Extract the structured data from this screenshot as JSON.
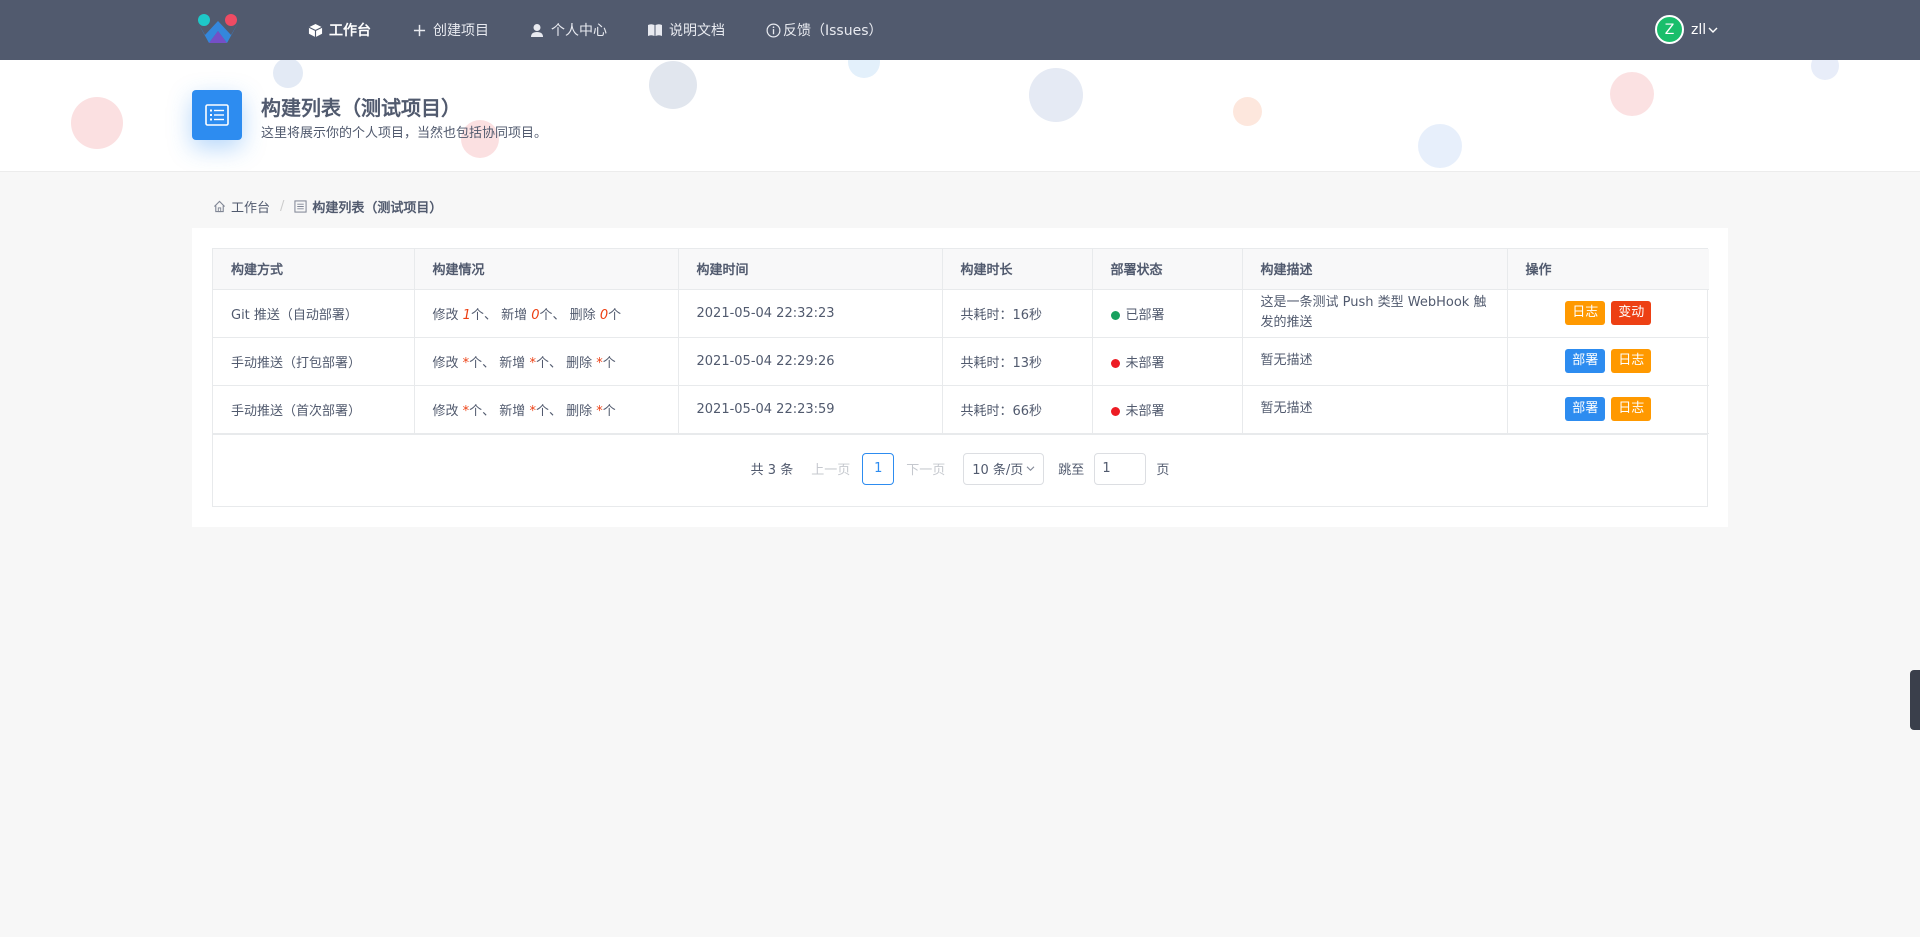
{
  "nav": {
    "items": [
      {
        "label": "工作台",
        "icon": "cube-icon",
        "active": true
      },
      {
        "label": "创建项目",
        "icon": "plus-icon"
      },
      {
        "label": "个人中心",
        "icon": "user-icon"
      },
      {
        "label": "说明文档",
        "icon": "book-icon"
      },
      {
        "label": "反馈（Issues）",
        "icon": "info-icon"
      }
    ]
  },
  "user": {
    "avatar_letter": "Z",
    "name": "zll"
  },
  "header": {
    "title": "构建列表（测试项目）",
    "subtitle": "这里将展示你的个人项目，当然也包括协同项目。"
  },
  "breadcrumb": {
    "home": "工作台",
    "current": "构建列表（测试项目）"
  },
  "table": {
    "columns": [
      "构建方式",
      "构建情况",
      "构建时间",
      "构建时长",
      "部署状态",
      "构建描述",
      "操作"
    ],
    "rows": [
      {
        "method": "Git 推送（自动部署）",
        "stats": {
          "modify_label": "修改",
          "modify": "1",
          "add_label": "、 新增",
          "add": "0",
          "del_label": "、 删除",
          "del": "0",
          "unit": "个"
        },
        "time": "2021-05-04 22:32:23",
        "duration": "共耗时：16秒",
        "status": "已部署",
        "status_color": "#19a15f",
        "description": "这是一条测试 Push 类型 WebHook 触发的推送",
        "ops": [
          {
            "label": "日志",
            "color": "orange"
          },
          {
            "label": "变动",
            "color": "red"
          }
        ]
      },
      {
        "method": "手动推送（打包部署）",
        "stats": {
          "modify_label": "修改",
          "modify": "*",
          "add_label": "、 新增",
          "add": "*",
          "del_label": "、 删除",
          "del": "*",
          "unit": "个"
        },
        "time": "2021-05-04 22:29:26",
        "duration": "共耗时：13秒",
        "status": "未部署",
        "status_color": "#ed1c24",
        "description": "暂无描述",
        "ops": [
          {
            "label": "部署",
            "color": "blue"
          },
          {
            "label": "日志",
            "color": "orange"
          }
        ]
      },
      {
        "method": "手动推送（首次部署）",
        "stats": {
          "modify_label": "修改",
          "modify": "*",
          "add_label": "、 新增",
          "add": "*",
          "del_label": "、 删除",
          "del": "*",
          "unit": "个"
        },
        "time": "2021-05-04 22:23:59",
        "duration": "共耗时：66秒",
        "status": "未部署",
        "status_color": "#ed1c24",
        "description": "暂无描述",
        "ops": [
          {
            "label": "部署",
            "color": "blue"
          },
          {
            "label": "日志",
            "color": "orange"
          }
        ]
      }
    ]
  },
  "pagination": {
    "total": "共 3 条",
    "prev": "上一页",
    "current_page": "1",
    "next": "下一页",
    "page_size": "10 条/页",
    "jump_label": "跳至",
    "jump_value": "1",
    "jump_unit": "页"
  },
  "colors": {
    "topbar": "#515a6e",
    "primary": "#2d8cf0",
    "warning": "#ff9900",
    "danger": "#ed4014",
    "success": "#19be6b"
  }
}
